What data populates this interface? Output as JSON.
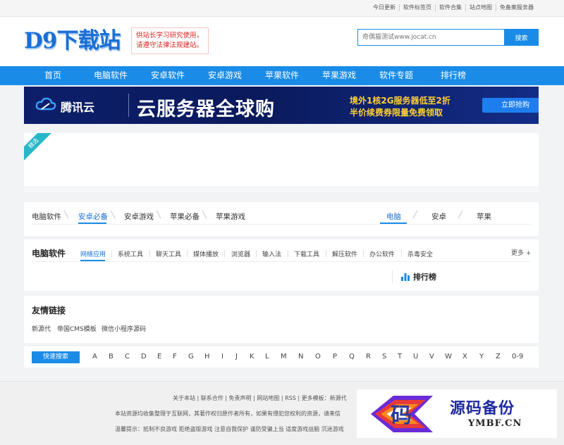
{
  "topbar": {
    "links": [
      "今日更新",
      "软件标签页",
      "软件合集",
      "站点地图",
      "免备案服务器"
    ]
  },
  "header": {
    "logo": "D9下载站",
    "notice_line1": "供站长学习研究使用，",
    "notice_line2": "请遵守法律法规建站。",
    "search_placeholder": "奇偶猫测试www.jocat.cn",
    "search_button": "搜索"
  },
  "nav": {
    "items": [
      "首页",
      "电脑软件",
      "安卓软件",
      "安卓游戏",
      "苹果软件",
      "苹果游戏",
      "软件专题",
      "排行榜"
    ]
  },
  "banner": {
    "brand": "腾讯云",
    "headline": "云服务器全球购",
    "line1": "境外1核2G服务器低至2折",
    "line2": "半价续费券限量免费领取",
    "cta": "立即抢购"
  },
  "featured": {
    "ribbon": "精选"
  },
  "category_tabs": {
    "left": [
      "电脑软件",
      "安卓必备",
      "安卓游戏",
      "苹果必备",
      "苹果游戏"
    ],
    "right": [
      "电脑",
      "安卓",
      "苹果"
    ]
  },
  "software": {
    "title": "电脑软件",
    "subtabs": [
      "网络应用",
      "系统工具",
      "聊天工具",
      "媒体播放",
      "浏览器",
      "输入法",
      "下载工具",
      "解压软件",
      "办公软件",
      "杀毒安全"
    ],
    "more": "更多 +",
    "rank_title": "排行榜"
  },
  "friends": {
    "title": "友情链接",
    "links": [
      "新源代",
      "帝国CMS模板",
      "微信小程序源码"
    ]
  },
  "letters": {
    "quick_search": "快速搜索",
    "list": [
      "A",
      "B",
      "C",
      "D",
      "E",
      "F",
      "G",
      "H",
      "I",
      "J",
      "K",
      "L",
      "M",
      "N",
      "O",
      "P",
      "Q",
      "R",
      "S",
      "T",
      "U",
      "V",
      "W",
      "X",
      "Y",
      "Z",
      "0-9"
    ]
  },
  "footer": {
    "line1": "关于本站 | 联系合作 | 免责声明 | 网站地图 | RSS | 更多模板：新源代",
    "line2": "本站资源均收集整理于互联网，其著作权归原作者所有，如果有侵犯您权利的资源，请来信",
    "line3": "温馨提示：抵制不良游戏 拒绝盗版游戏 注意自我保护 谨防受骗上当 适度游戏益脑 沉迷游戏"
  },
  "watermark": {
    "badge_char": "码",
    "cn": "源码备份",
    "en": "YMBF.CN"
  },
  "colors": {
    "primary": "#1a8ce8",
    "logo": "#1a6fd6",
    "notice_red": "#e02020",
    "banner_bg": "#0d1f6a",
    "banner_yellow": "#ffcf33"
  }
}
